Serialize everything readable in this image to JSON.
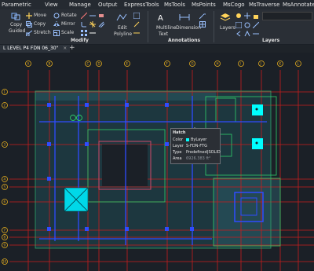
{
  "menu": [
    "Parametric",
    "View",
    "Manage",
    "Output",
    "ExpressTools",
    "MsTools",
    "MsPoints",
    "MsCogo",
    "MsTraverse",
    "MsAnnotate"
  ],
  "ribbon": {
    "modify": {
      "move": "Move",
      "rotate": "Rotate",
      "copy": "Copy",
      "mirror": "Mirror",
      "stretch": "Stretch",
      "scale": "Scale",
      "copy_guided_1": "Copy",
      "copy_guided_2": "Guided",
      "edit_polyline_1": "Edit",
      "edit_polyline_2": "Polyline",
      "group": "Modify"
    },
    "annotations": {
      "multiline_1": "Multiline",
      "multiline_2": "Text",
      "dimension": "Dimension",
      "group": "Annotations"
    },
    "layers": {
      "layers_button": "Layers",
      "group": "Layers"
    }
  },
  "doc_tab": {
    "title": "L LEVEL P4 FDN 06_30\"",
    "add": "+"
  },
  "grid": {
    "top_labels": [
      "A",
      "B",
      "C",
      "D",
      "E",
      "F",
      "G",
      "H",
      "I",
      "J",
      "K",
      "L"
    ],
    "left_labels": [
      "1",
      "2",
      "3",
      "4",
      "5",
      "6",
      "7",
      "8",
      "9",
      "10"
    ]
  },
  "tooltip": {
    "title": "Hatch",
    "rows": [
      {
        "key": "Color",
        "value": "ByLayer"
      },
      {
        "key": "Layer",
        "value": "S-FDN-FTG"
      },
      {
        "key": "Type",
        "value": "Predefined|SOLID"
      },
      {
        "key": "Area",
        "value": "6926.383 ft²"
      }
    ]
  },
  "colors": {
    "gridline": "#d42a2a",
    "cyan": "#00ffff",
    "blue": "#2f4cff",
    "green": "#2fcf6a",
    "background": "#1b2027"
  }
}
